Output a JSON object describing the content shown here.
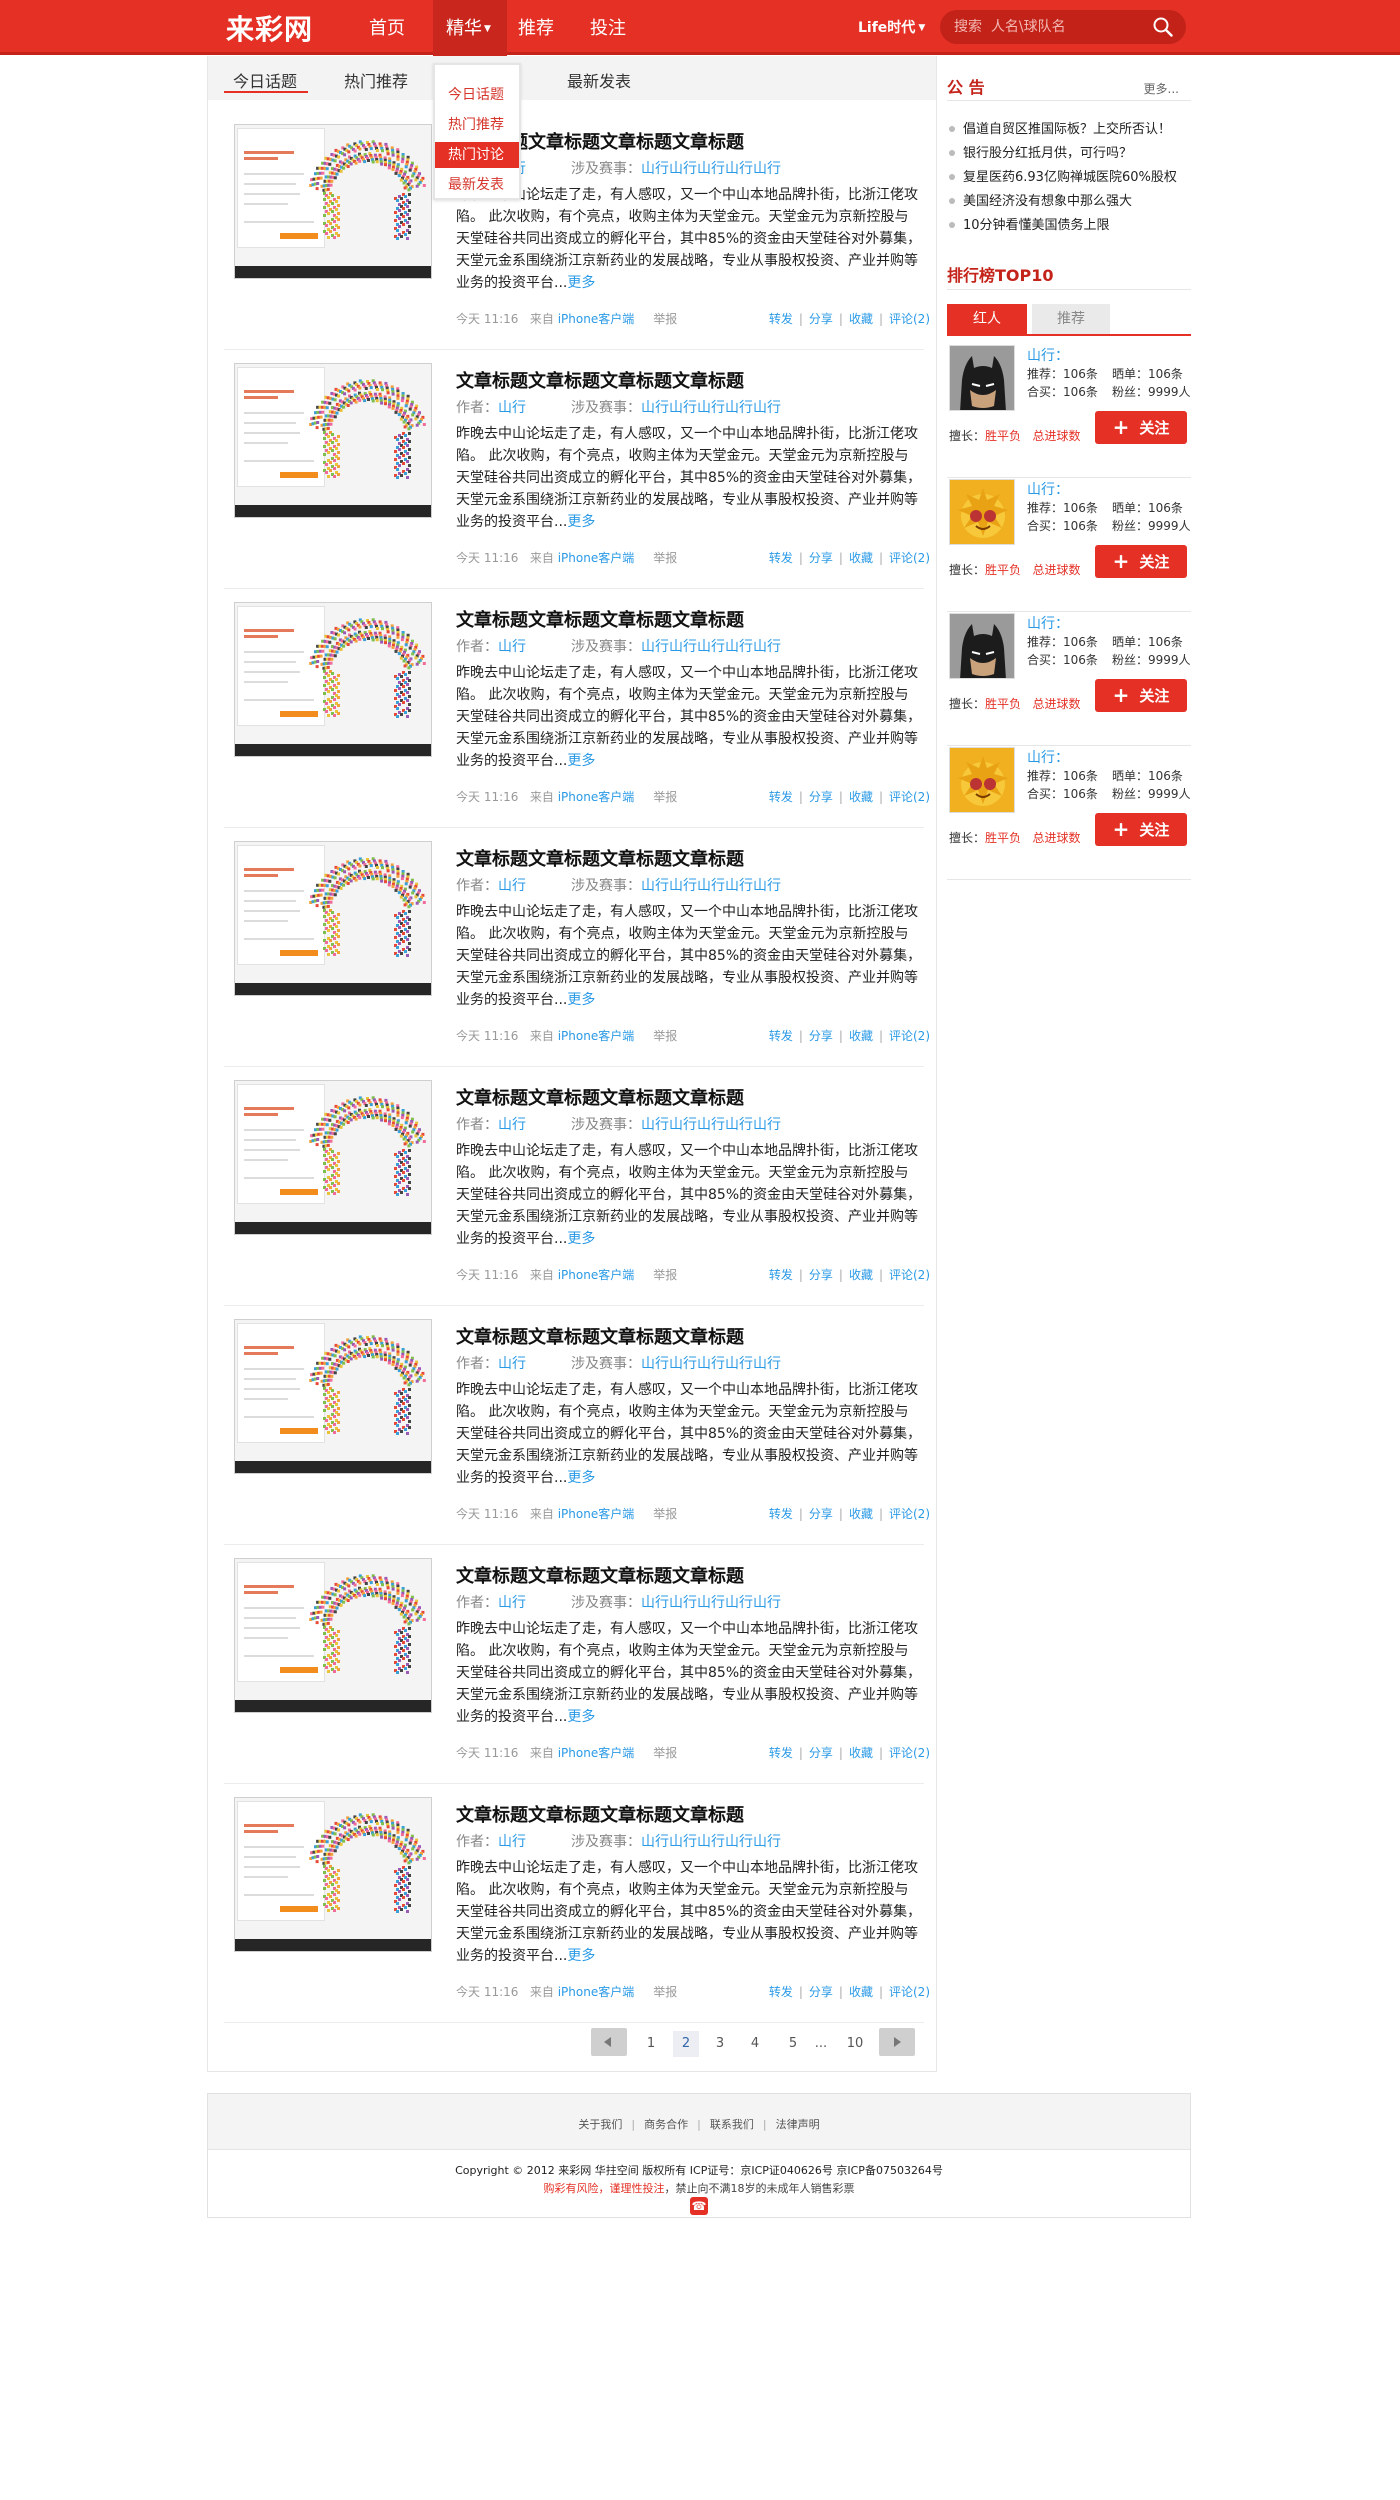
{
  "site": {
    "logo": "来彩网"
  },
  "nav": {
    "items": [
      "首页",
      "精华",
      "推荐",
      "投注"
    ],
    "life_label": "Life时代"
  },
  "search": {
    "placeholder": "搜索  人名\\球队名"
  },
  "dropdown": {
    "items": [
      "今日话题",
      "热门推荐",
      "热门讨论",
      "最新发表"
    ],
    "active": "热门讨论"
  },
  "tabs": [
    "今日话题",
    "热门推荐",
    "最新发表"
  ],
  "article": {
    "title": "文章标题文章标题文章标题文章标题",
    "author_label": "作者：",
    "author": "山行",
    "involve_label": "涉及赛事：",
    "involve": "山行山行山行山行山行",
    "body": "昨晚去中山论坛走了走，有人感叹，又一个中山本地品牌扑街，比浙江佬攻陷。 此次收购，有个亮点，收购主体为天堂金元。天堂金元为京新控股与天堂硅谷共同出资成立的孵化平台，其中85%的资金由天堂硅谷对外募集，天堂元金系围绕浙江京新药业的发展战略，专业从事股权投资、产业并购等业务的投资平台...",
    "more": "更多",
    "time": "今天 11:16",
    "from_label": "来自",
    "client": "iPhone客户端",
    "report": "举报",
    "actions": [
      "转发",
      "分享",
      "收藏",
      "评论(2)"
    ]
  },
  "pagination": {
    "pages": [
      "1",
      "2",
      "3",
      "4",
      "5",
      "10"
    ],
    "current": "2",
    "ellipsis": "..."
  },
  "notice": {
    "title": "公 告",
    "more": "更多...",
    "items": [
      "倡道自贸区推国际板？上交所否认！",
      "银行股分红抵月供，可行吗？",
      "复星医药6.93亿购禅城医院60%股权",
      "美国经济没有想象中那么强大",
      "10分钟看懂美国债务上限"
    ]
  },
  "ranking": {
    "title": "排行榜TOP10",
    "tabs": [
      "红人",
      "推荐"
    ],
    "items": [
      {
        "name": "山行：",
        "avatar": "batman-avatar",
        "recommend": "推荐：106条",
        "posted": "晒单：106条",
        "bought": "合买：106条",
        "fans": "粉丝：9999人",
        "specialty_label": "擅长：",
        "specialty1": "胜平负",
        "specialty2": "总进球数",
        "follow": "关注"
      },
      {
        "name": "山行：",
        "avatar": "fruit-avatar",
        "recommend": "推荐：106条",
        "posted": "晒单：106条",
        "bought": "合买：106条",
        "fans": "粉丝：9999人",
        "specialty_label": "擅长：",
        "specialty1": "胜平负",
        "specialty2": "总进球数",
        "follow": "关注"
      },
      {
        "name": "山行：",
        "avatar": "batman-avatar",
        "recommend": "推荐：106条",
        "posted": "晒单：106条",
        "bought": "合买：106条",
        "fans": "粉丝：9999人",
        "specialty_label": "擅长：",
        "specialty1": "胜平负",
        "specialty2": "总进球数",
        "follow": "关注"
      },
      {
        "name": "山行：",
        "avatar": "fruit-avatar",
        "recommend": "推荐：106条",
        "posted": "晒单：106条",
        "bought": "合买：106条",
        "fans": "粉丝：9999人",
        "specialty_label": "擅长：",
        "specialty1": "胜平负",
        "specialty2": "总进球数",
        "follow": "关注"
      }
    ]
  },
  "footer": {
    "links": [
      "关于我们",
      "商务合作",
      "联系我们",
      "法律声明"
    ],
    "copyright": "Copyright © 2012  来彩网  华拄空间  版权所有  ICP证号：京ICP证040626号  京ICP备07503264号",
    "warning_red": "购彩有风险，谨理性投注",
    "warning_rest": "，禁止向不满18岁的未成年人销售彩票"
  },
  "colors": {
    "brand": "#e43025",
    "link": "#2a9ae6"
  }
}
